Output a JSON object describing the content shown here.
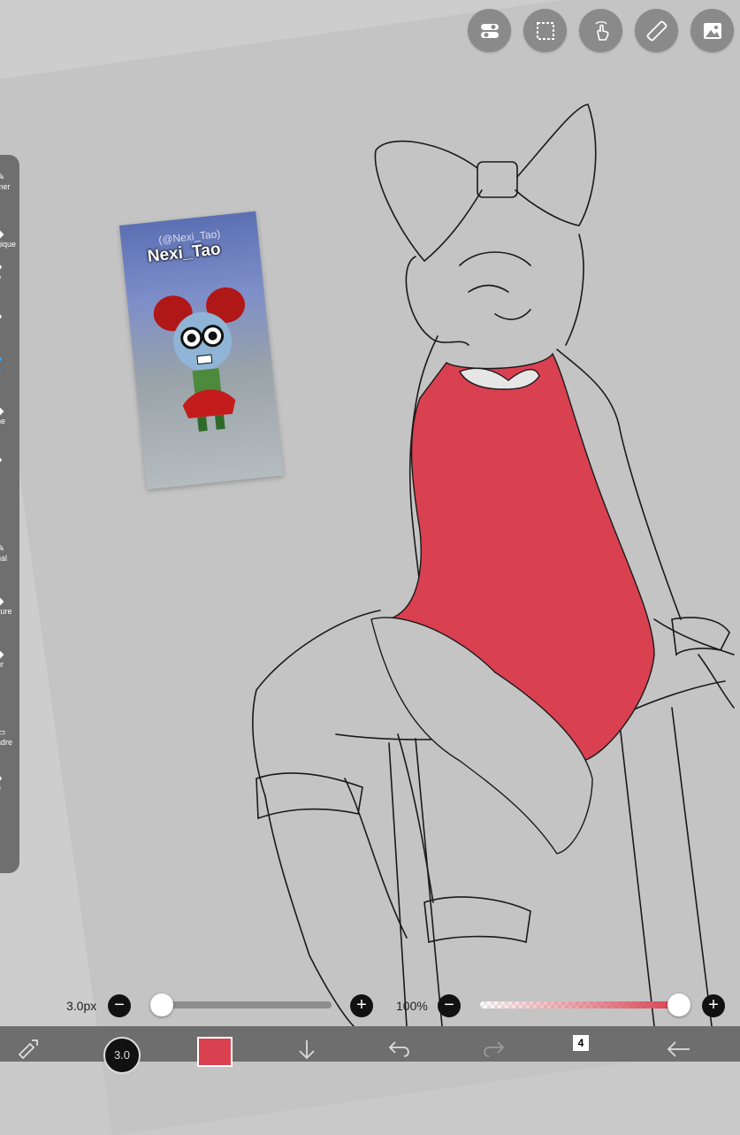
{
  "reference": {
    "handle": "(@Nexi_Tao)",
    "name": "Nexi_Tao"
  },
  "top_tools": [
    {
      "name": "toggle-icon"
    },
    {
      "name": "selection-icon"
    },
    {
      "name": "touch-gesture-icon"
    },
    {
      "name": "ruler-icon"
    },
    {
      "name": "image-icon"
    }
  ],
  "side_toolbar": {
    "items": [
      {
        "glyph": "✎",
        "label": "mer"
      },
      {
        "glyph": "◆",
        "label": "gique"
      },
      {
        "glyph": "●",
        "label": "o"
      },
      {
        "glyph": "●",
        "label": ""
      },
      {
        "glyph": "●",
        "label": "e"
      },
      {
        "glyph": "◆",
        "label": "ne"
      },
      {
        "glyph": "●",
        "label": ""
      },
      {
        "glyph": "✎",
        "label": "ual"
      },
      {
        "glyph": "◆",
        "label": "iture"
      },
      {
        "glyph": "◆",
        "label": "ur"
      },
      {
        "glyph": "▭",
        "label": "adre"
      },
      {
        "glyph": "●",
        "label": "e"
      }
    ]
  },
  "brush_size": {
    "value_text": "3.0px",
    "minus": "−",
    "plus": "+",
    "level": 0.0
  },
  "opacity": {
    "value_text": "100%",
    "minus": "−",
    "plus": "+",
    "level": 1.0
  },
  "bottom_bar": {
    "brush_size_label": "3.0",
    "layer_count": "4",
    "primary_color": "#d94050"
  },
  "colors": {
    "dress_red": "#d94050",
    "panel_grey": "#6f6f6f",
    "active_blue": "#3da7ff"
  }
}
